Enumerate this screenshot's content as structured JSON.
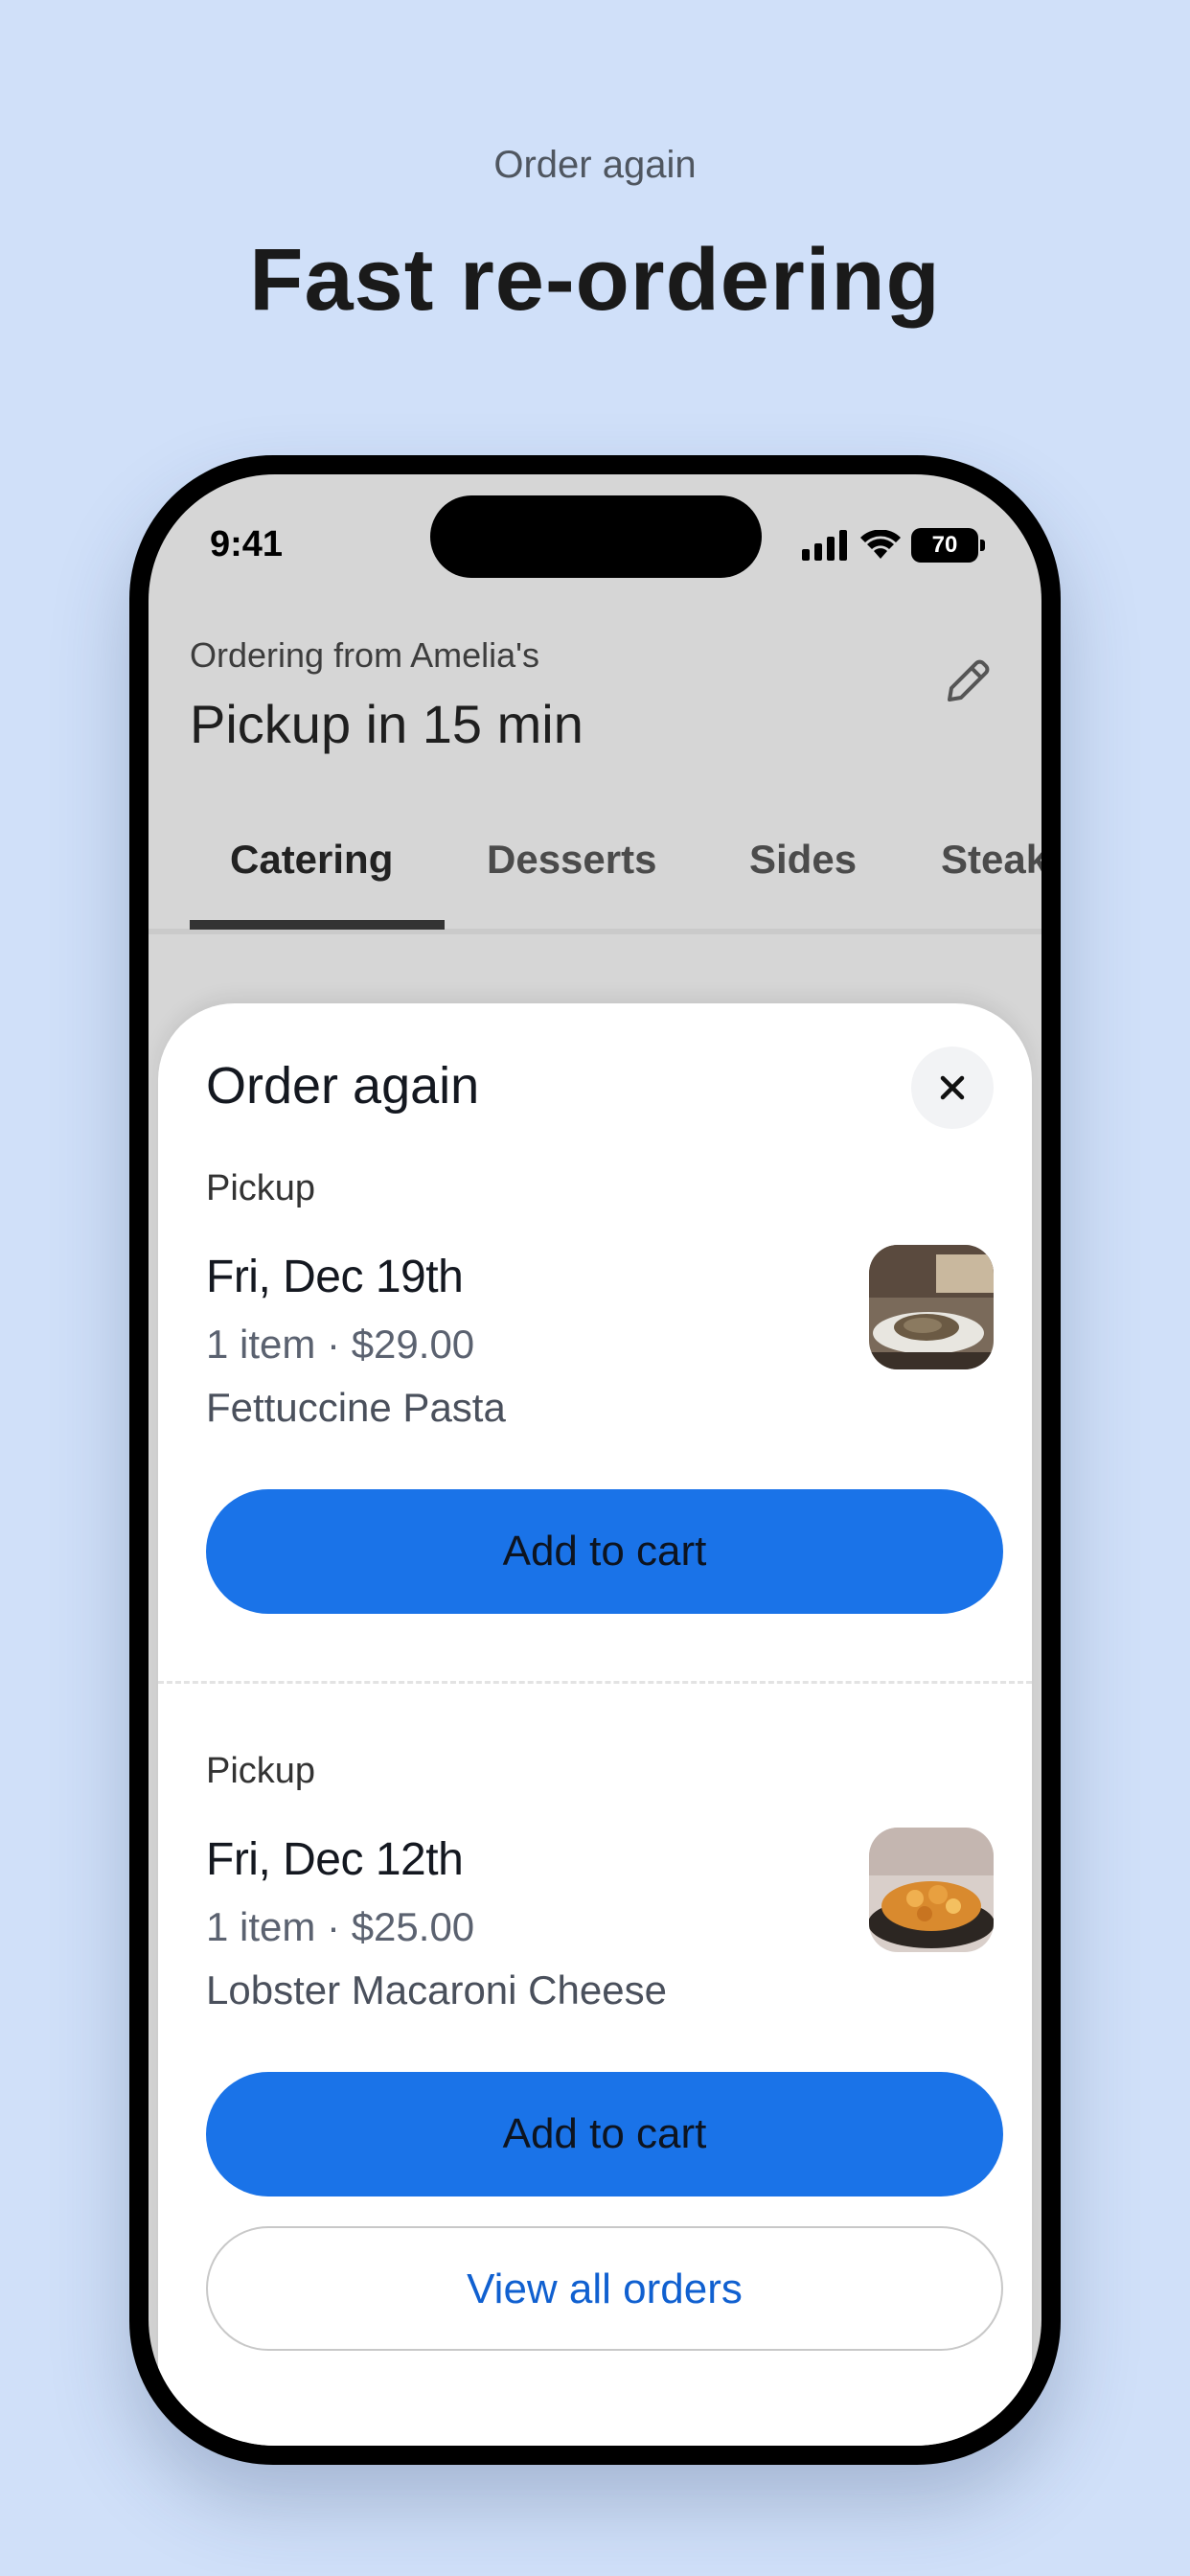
{
  "promo": {
    "eyebrow": "Order again",
    "headline": "Fast re-ordering"
  },
  "status_bar": {
    "time": "9:41",
    "battery": "70",
    "icons": [
      "signal-icon",
      "wifi-icon",
      "battery-icon"
    ]
  },
  "header": {
    "subtitle": "Ordering from Amelia's",
    "title": "Pickup in 15 min",
    "edit_icon": "pencil-icon"
  },
  "tabs": [
    {
      "label": "Catering",
      "active": true
    },
    {
      "label": "Desserts",
      "active": false
    },
    {
      "label": "Sides",
      "active": false
    },
    {
      "label": "Steak",
      "active": false
    }
  ],
  "sheet": {
    "title": "Order again",
    "close_icon": "close-icon",
    "orders": [
      {
        "type": "Pickup",
        "date": "Fri, Dec 19th",
        "meta": "1 item · $29.00",
        "item": "Fettuccine Pasta",
        "button": "Add to cart"
      },
      {
        "type": "Pickup",
        "date": "Fri, Dec 12th",
        "meta": "1 item · $25.00",
        "item": "Lobster Macaroni Cheese",
        "button": "Add to cart"
      }
    ],
    "view_all": "View all orders"
  },
  "colors": {
    "background": "#d0e0f9",
    "primary_button": "#1a73e8",
    "link": "#1060d0"
  }
}
